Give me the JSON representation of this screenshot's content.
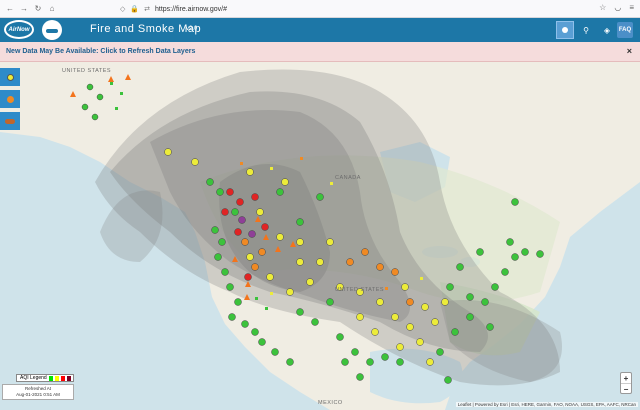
{
  "browser": {
    "url": "https://fire.airnow.gov/#",
    "nav_icons": [
      "back-icon",
      "forward-icon",
      "reload-icon",
      "home-icon"
    ]
  },
  "header": {
    "logo_text": "AirNow",
    "title": "Fire and Smoke Map",
    "version": "v2.0",
    "faq_label": "FAQ"
  },
  "notice": {
    "text": "New Data May Be Available: Click to Refresh Data Layers",
    "close": "×"
  },
  "map": {
    "labels": {
      "canada": "CANADA",
      "united_states": "UNITED STATES",
      "mexico": "MEXICO",
      "alaska": "UNITED STATES"
    },
    "smoke_color": "#7a7a7a",
    "land_color": "#f2efe6",
    "water_color": "#cfe3ea"
  },
  "legend": {
    "label": "AQI Legend",
    "colors": [
      "#00e400",
      "#ffff00",
      "#ff7e00",
      "#ff0000",
      "#8f3f97",
      "#7e0023"
    ]
  },
  "refreshed": {
    "line1": "Refreshed At",
    "line2": "Aug-01-2021 0:51 AM"
  },
  "zoom": {
    "in": "+",
    "out": "−"
  },
  "attribution": "Leaflet | Powered by Esri | Esri, HERE, Garmin, FAO, NOAA, USGS, EPA, AAFC, NRCan"
}
